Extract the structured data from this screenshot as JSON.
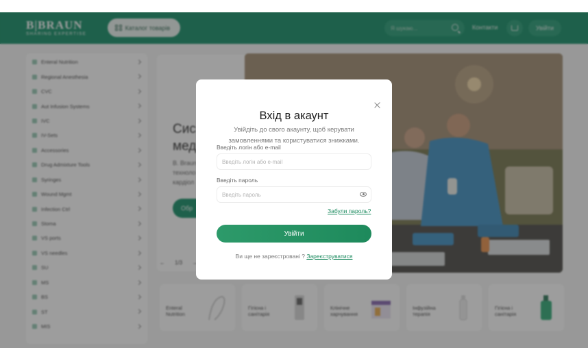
{
  "header": {
    "logo_main": "B|BRAUN",
    "logo_tagline": "SHARING EXPERTISE",
    "catalog_label": "Каталог товарів",
    "search_placeholder": "Я шукаю...",
    "contacts_label": "Контакти",
    "login_label": "Увійти"
  },
  "sidebar": {
    "items": [
      {
        "label": "Enteral Nutrition"
      },
      {
        "label": "Regional Anesthesia"
      },
      {
        "label": "CVC"
      },
      {
        "label": "Aut Infusion Systems"
      },
      {
        "label": "IVC"
      },
      {
        "label": "IV-Sets"
      },
      {
        "label": "Accessories"
      },
      {
        "label": "Drug Admixture Tools"
      },
      {
        "label": "Syringes"
      },
      {
        "label": "Wound Mgmt"
      },
      {
        "label": "Infection Ctrl"
      },
      {
        "label": "Stoma"
      },
      {
        "label": "VS ports"
      },
      {
        "label": "VS needles"
      },
      {
        "label": "SU"
      },
      {
        "label": "MS"
      },
      {
        "label": "BS"
      },
      {
        "label": "ST"
      },
      {
        "label": "MIS"
      }
    ]
  },
  "hero": {
    "title_line1": "Сис",
    "title_line2": "мед",
    "sub_line1": "B. Braun",
    "sub_line2": "техноло",
    "sub_line3": "кардіол",
    "button_label": "Обр",
    "pager": "1/3"
  },
  "tiles": [
    {
      "label": "Enteral Nutrition"
    },
    {
      "label": "Гігієна і санітарія"
    },
    {
      "label": "Клінічне харчування"
    },
    {
      "label": "Інфузійна терапія"
    },
    {
      "label": "Гігієна і санітарія"
    }
  ],
  "modal": {
    "title": "Вхід в акаунт",
    "subtitle": "Увійдіть до свого акаунту, щоб керувати замовленнями та користуватися знижками.",
    "login_label": "Введіть логін або e-mail",
    "login_placeholder": "Введіть логін або e-mail",
    "password_label": "Введіть пароль",
    "password_placeholder": "Введіть пароль",
    "forgot_label": "Забули пароль?",
    "submit_label": "Увійти",
    "register_prompt": "Ви ще не зареєстровані ?",
    "register_link": "Зареєструватися"
  },
  "colors": {
    "brand_green": "#00855a",
    "button_green": "#2d9a6a",
    "link_green": "#1a8a5e"
  }
}
